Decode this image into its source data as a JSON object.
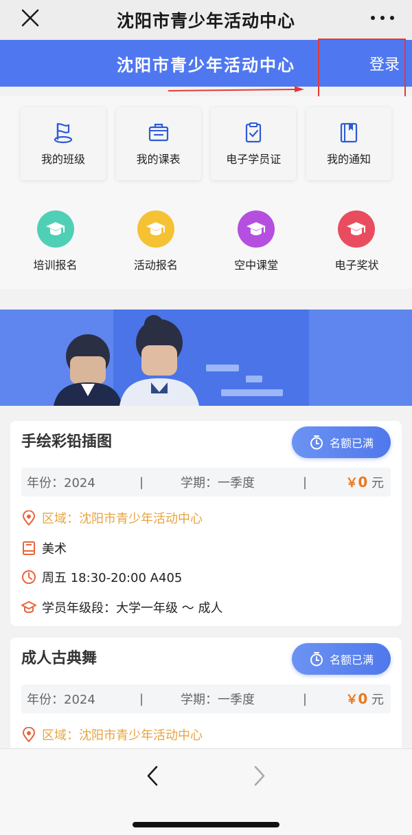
{
  "wechat_bar": {
    "title": "沈阳市青少年活动中心",
    "close_icon": "close-icon",
    "more_icon": "more-dots-icon"
  },
  "header": {
    "title": "沈阳市青少年活动中心",
    "login_label": "登录"
  },
  "quick_menu": [
    {
      "label": "我的班级",
      "icon": "class-flag-icon"
    },
    {
      "label": "我的课表",
      "icon": "schedule-icon"
    },
    {
      "label": "电子学员证",
      "icon": "student-card-icon"
    },
    {
      "label": "我的通知",
      "icon": "notice-book-icon"
    }
  ],
  "circle_menu": [
    {
      "label": "培训报名",
      "icon": "graduation-cap-icon",
      "color": "#4fd0b6"
    },
    {
      "label": "活动报名",
      "icon": "graduation-cap-icon",
      "color": "#f5c233"
    },
    {
      "label": "空中课堂",
      "icon": "graduation-cap-icon",
      "color": "#b54fe0"
    },
    {
      "label": "电子奖状",
      "icon": "graduation-cap-icon",
      "color": "#ea4c5f"
    }
  ],
  "courses": [
    {
      "title": "手绘彩铅插图",
      "status": "名额已满",
      "year": "年份：2024",
      "term": "学期：一季度",
      "separator": "|",
      "price_symbol": "￥",
      "price_value": "0",
      "price_unit": "元",
      "region": "区域：沈阳市青少年活动中心",
      "category": "美术",
      "time": "周五 18:30-20:00 A405",
      "grade": "学员年级段：大学一年级 ～ 成人"
    },
    {
      "title": "成人古典舞",
      "status": "名额已满",
      "year": "年份：2024",
      "term": "学期：一季度",
      "separator": "|",
      "price_symbol": "￥",
      "price_value": "0",
      "price_unit": "元",
      "region": "区域：沈阳市青少年活动中心"
    }
  ],
  "colors": {
    "accent": "#4f78f0",
    "price": "#e8791f",
    "region": "#e8a33f",
    "icon_orange": "#e8643c",
    "highlight": "#e53935"
  }
}
